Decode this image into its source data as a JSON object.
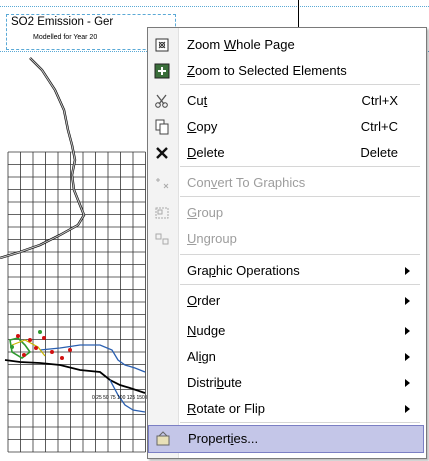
{
  "document": {
    "title": "SO2 Emission - Ger",
    "subtitle": "Modelled for Year 20",
    "scale_label": "0 25 50 75 100 125 150 km"
  },
  "menu": {
    "items": [
      {
        "pre": "Zoom ",
        "acc": "W",
        "post": "hole Page",
        "shortcut": "",
        "icon": "zoom-whole-page-icon",
        "disabled": false,
        "submenu": false
      },
      {
        "pre": "",
        "acc": "Z",
        "post": "oom to Selected Elements",
        "shortcut": "",
        "icon": "zoom-selected-icon",
        "disabled": false,
        "submenu": false
      },
      {
        "pre": "Cu",
        "acc": "t",
        "post": "",
        "shortcut": "Ctrl+X",
        "icon": "scissors-icon",
        "disabled": false,
        "submenu": false
      },
      {
        "pre": "",
        "acc": "C",
        "post": "opy",
        "shortcut": "Ctrl+C",
        "icon": "copy-icon",
        "disabled": false,
        "submenu": false
      },
      {
        "pre": "",
        "acc": "D",
        "post": "elete",
        "shortcut": "Delete",
        "icon": "delete-x-icon",
        "disabled": false,
        "submenu": false
      },
      {
        "pre": "Con",
        "acc": "v",
        "post": "ert To Graphics",
        "shortcut": "",
        "icon": "convert-graphics-icon",
        "disabled": true,
        "submenu": false
      },
      {
        "pre": "",
        "acc": "G",
        "post": "roup",
        "shortcut": "",
        "icon": "group-icon",
        "disabled": true,
        "submenu": false
      },
      {
        "pre": "",
        "acc": "U",
        "post": "ngroup",
        "shortcut": "",
        "icon": "ungroup-icon",
        "disabled": true,
        "submenu": false
      },
      {
        "pre": "Gra",
        "acc": "p",
        "post": "hic Operations",
        "shortcut": "",
        "icon": "",
        "disabled": false,
        "submenu": true
      },
      {
        "pre": "",
        "acc": "O",
        "post": "rder",
        "shortcut": "",
        "icon": "",
        "disabled": false,
        "submenu": true
      },
      {
        "pre": "",
        "acc": "N",
        "post": "udge",
        "shortcut": "",
        "icon": "",
        "disabled": false,
        "submenu": true
      },
      {
        "pre": "Al",
        "acc": "i",
        "post": "gn",
        "shortcut": "",
        "icon": "",
        "disabled": false,
        "submenu": true
      },
      {
        "pre": "Distri",
        "acc": "b",
        "post": "ute",
        "shortcut": "",
        "icon": "",
        "disabled": false,
        "submenu": true
      },
      {
        "pre": "",
        "acc": "R",
        "post": "otate or Flip",
        "shortcut": "",
        "icon": "",
        "disabled": false,
        "submenu": true
      },
      {
        "pre": "Propert",
        "acc": "i",
        "post": "es...",
        "shortcut": "",
        "icon": "properties-icon",
        "disabled": false,
        "submenu": false,
        "highlighted": true
      }
    ]
  }
}
